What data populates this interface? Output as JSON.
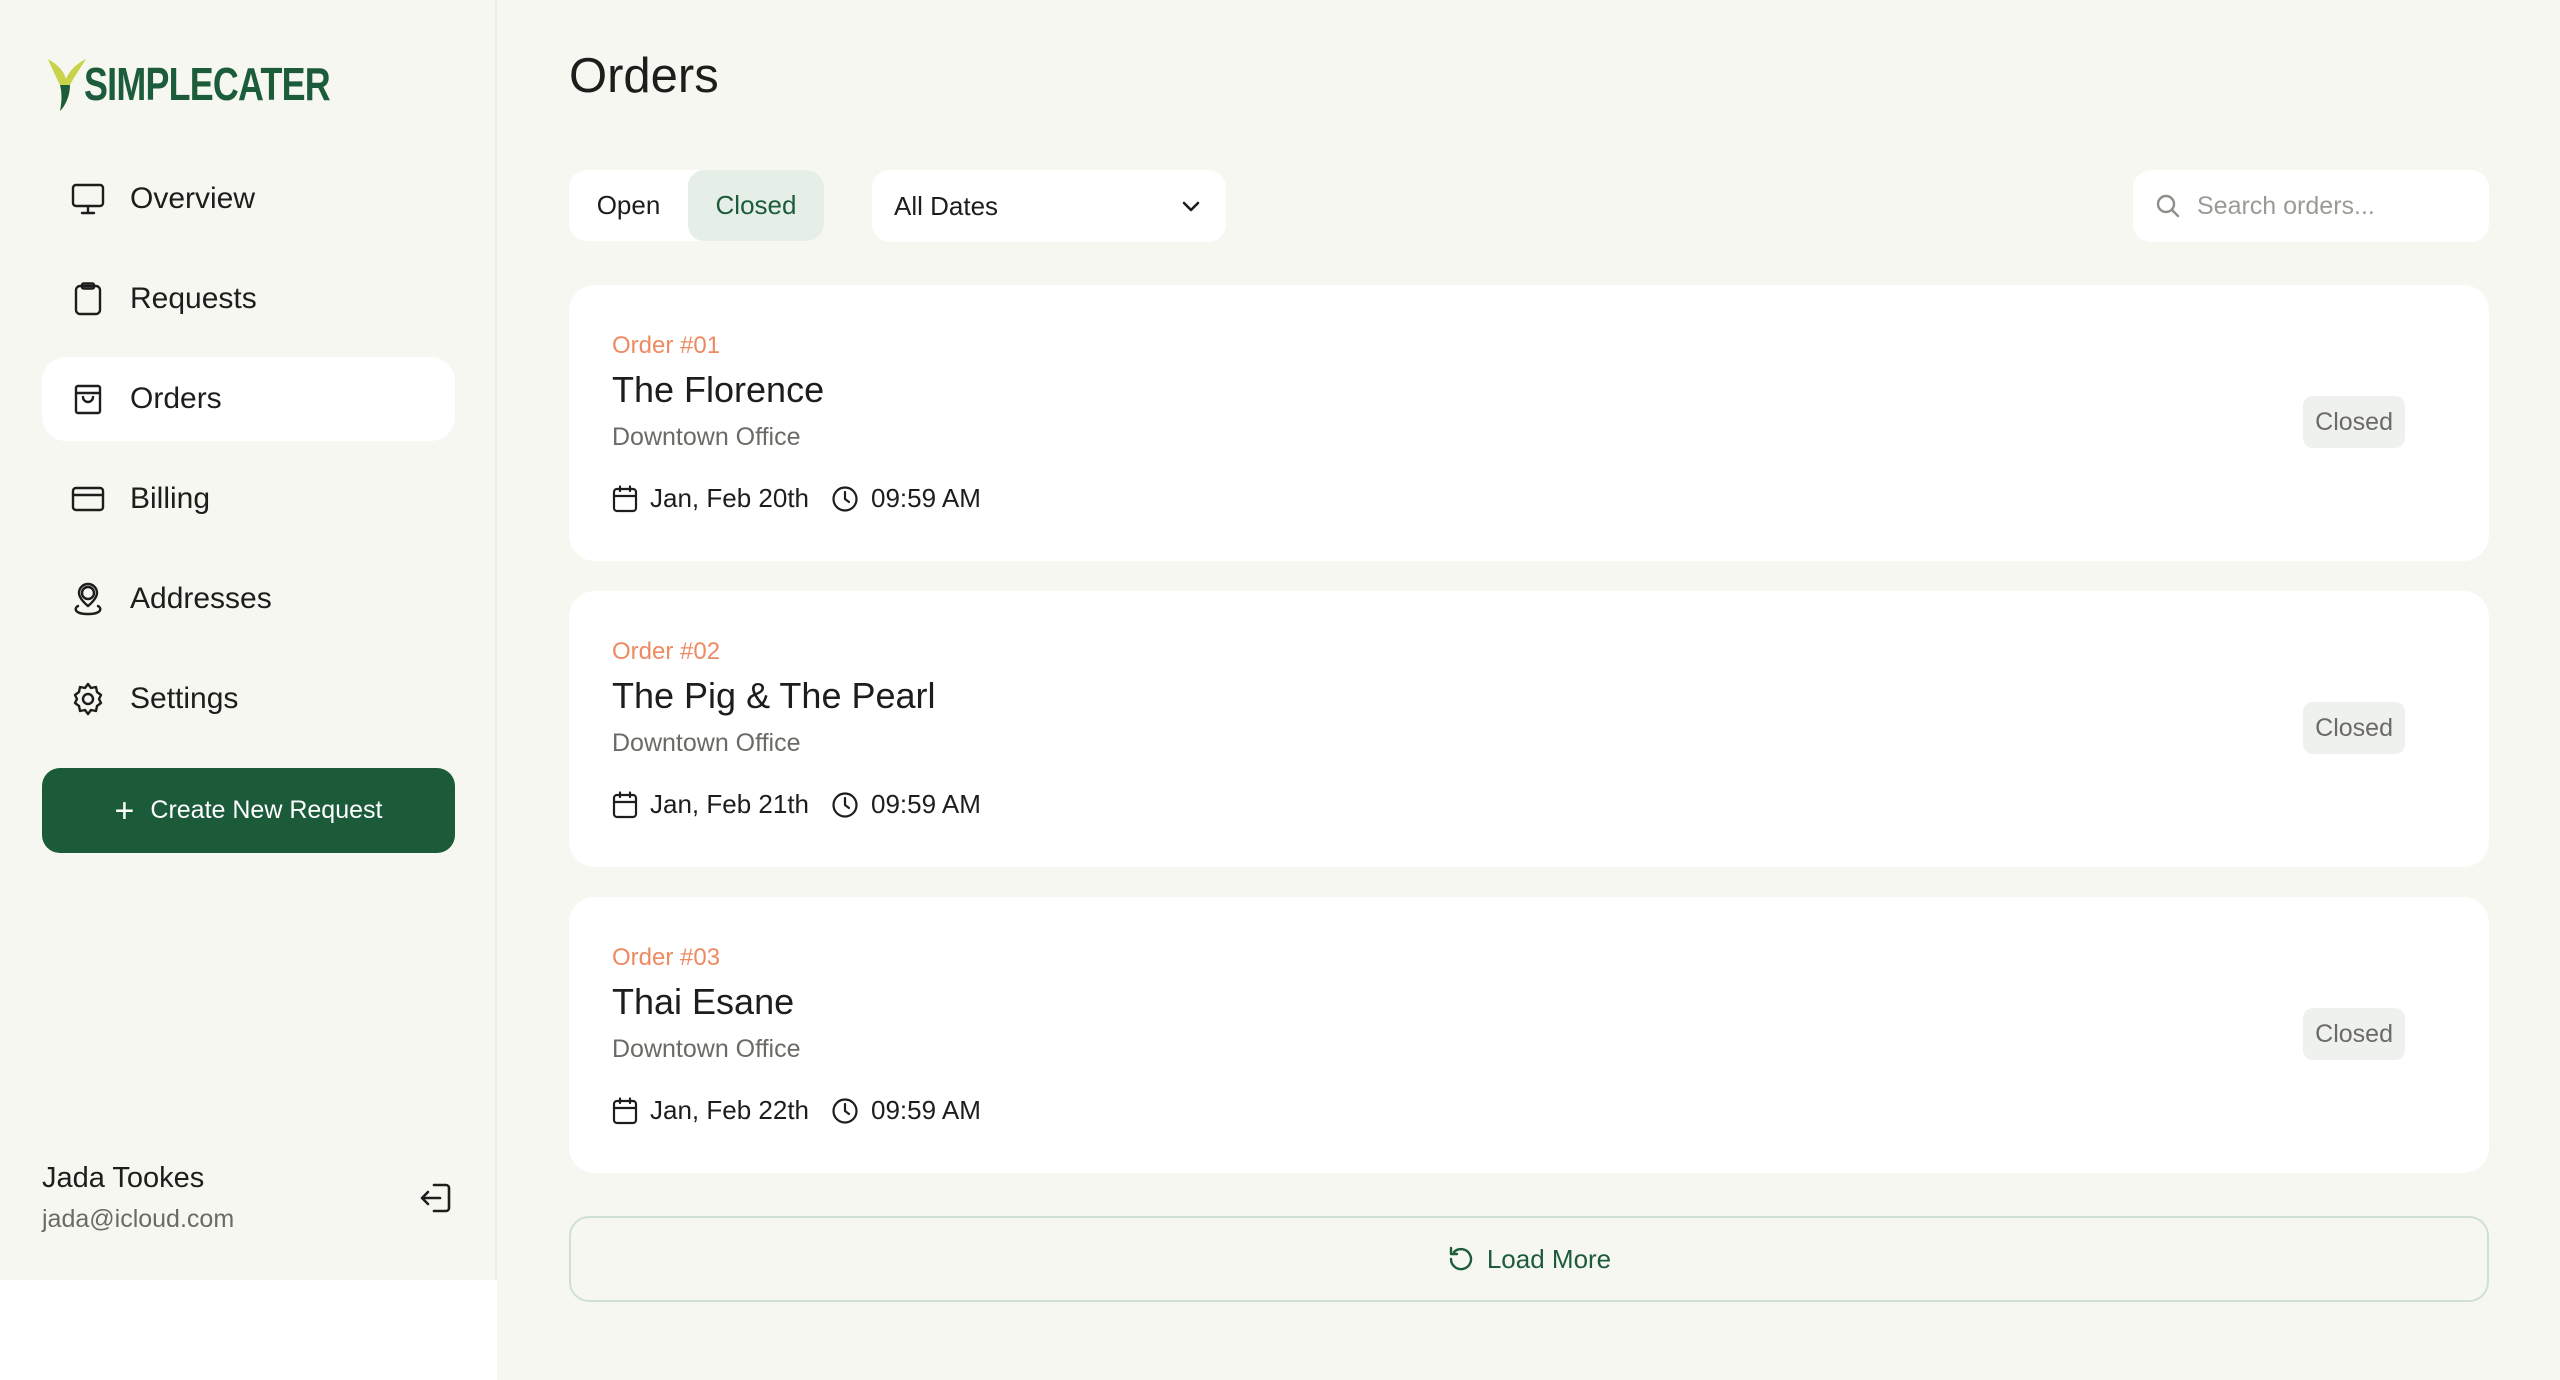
{
  "brand": {
    "name": "SIMPLECATER",
    "color": "#1d5c3b",
    "accent": "#c9d34a"
  },
  "sidebar": {
    "items": [
      {
        "label": "Overview",
        "icon": "monitor-icon",
        "active": false
      },
      {
        "label": "Requests",
        "icon": "clipboard-icon",
        "active": false
      },
      {
        "label": "Orders",
        "icon": "shopping-bag-icon",
        "active": true
      },
      {
        "label": "Billing",
        "icon": "credit-card-icon",
        "active": false
      },
      {
        "label": "Addresses",
        "icon": "map-pin-icon",
        "active": false
      },
      {
        "label": "Settings",
        "icon": "gear-icon",
        "active": false
      }
    ],
    "create_button": "Create New Request",
    "user": {
      "name": "Jada Tookes",
      "email": "jada@icloud.com"
    }
  },
  "main": {
    "title": "Orders",
    "filter_tabs": {
      "open": "Open",
      "closed": "Closed",
      "selected": "Closed"
    },
    "date_filter": {
      "selected": "All Dates"
    },
    "search": {
      "placeholder": "Search orders...",
      "value": ""
    },
    "orders": [
      {
        "number": "Order #01",
        "name": "The Florence",
        "location": "Downtown Office",
        "date": "Jan, Feb 20th",
        "time": "09:59 AM",
        "status": "Closed"
      },
      {
        "number": "Order #02",
        "name": "The Pig & The Pearl",
        "location": "Downtown Office",
        "date": "Jan, Feb 21th",
        "time": "09:59 AM",
        "status": "Closed"
      },
      {
        "number": "Order #03",
        "name": "Thai Esane",
        "location": "Downtown Office",
        "date": "Jan, Feb 22th",
        "time": "09:59 AM",
        "status": "Closed"
      }
    ],
    "load_more": "Load More"
  }
}
